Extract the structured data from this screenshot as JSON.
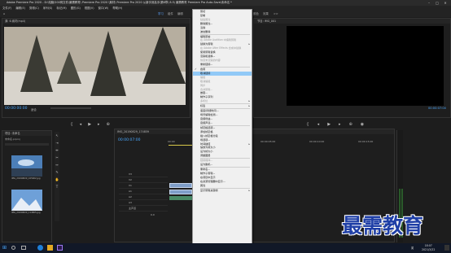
{
  "window": {
    "title": "Adobe Premiere Pro 2020 - D:\\电脑\\500例文件\\最需教育\\ Premiere Pro 2020 \\素材\\ Premiere Pro 2020 从新手到高手\\第8章\\ 8.5\\ 最需教育 Premiere Pro Auto-Save\\未命名 *"
  },
  "menu": [
    "文件(F)",
    "编辑(E)",
    "剪辑(C)",
    "序列(S)",
    "标记(M)",
    "图形(G)",
    "视图(V)",
    "窗口(W)",
    "帮助(H)"
  ],
  "workspace": {
    "home_label": "主页",
    "tabs": [
      "学习",
      "组件",
      "编辑",
      "颜色",
      "效果"
    ],
    "active_index": 0,
    "accent": "#5ca3ff",
    "more_label": ">>"
  },
  "source_monitor": {
    "tab": "源: 6.素材(mp4)",
    "timecode": "00:00:00:00",
    "zoom": "适合"
  },
  "program_monitor": {
    "tab": "节目: IMG_001",
    "timecode": "00:00:07:00"
  },
  "project_panel": {
    "tab": "项目: 未命名",
    "file": "未命名.prproj",
    "items": [
      {
        "name": "IMG_20190829_105902.jpg",
        "duration": "5:00"
      },
      {
        "name": "IMG_20190829_114805.jpg",
        "duration": "5:00"
      }
    ]
  },
  "timeline": {
    "tab": "IMG_20190829_174859",
    "timecode": "00:00:07:00",
    "ruler": [
      "00:00",
      "00:00:05:00",
      "00:00:10:00",
      "00:00:15:00"
    ],
    "tracks": [
      "V3",
      "V2",
      "V1",
      "A1",
      "A2",
      "A3",
      "主声道"
    ],
    "master_value": "0.0"
  },
  "context_menu": {
    "items": [
      {
        "label": "剪切",
        "state": "normal"
      },
      {
        "label": "复制",
        "state": "normal"
      },
      {
        "label": "粘贴属性",
        "state": "disabled"
      },
      {
        "label": "删除属性...",
        "state": "normal"
      },
      {
        "label": "清除",
        "state": "normal"
      },
      {
        "label": "波纹删除",
        "state": "normal"
      },
      {
        "sep": true
      },
      {
        "label": "编辑原始",
        "state": "normal"
      },
      {
        "label": "在 Adobe Audition 中编辑剪辑",
        "state": "disabled"
      },
      {
        "label": "替换为剪辑",
        "state": "normal",
        "arrow": true
      },
      {
        "label": "在 Adobe After Effects 合成中替换",
        "state": "disabled"
      },
      {
        "label": "使用剪辑替换",
        "state": "normal"
      },
      {
        "label": "渲染和替换...",
        "state": "normal"
      },
      {
        "label": "恢复未渲染的内容",
        "state": "disabled"
      },
      {
        "label": "重新链接...",
        "state": "normal"
      },
      {
        "sep": true
      },
      {
        "label": "启用",
        "state": "normal",
        "check": true
      },
      {
        "label": "取消链接",
        "state": "highlight"
      },
      {
        "label": "编组",
        "state": "disabled"
      },
      {
        "label": "取消编组",
        "state": "disabled"
      },
      {
        "label": "同步",
        "state": "disabled"
      },
      {
        "label": "合并剪辑...",
        "state": "disabled"
      },
      {
        "label": "嵌套...",
        "state": "normal"
      },
      {
        "label": "制作子序列",
        "state": "normal"
      },
      {
        "label": "多机位",
        "state": "disabled",
        "arrow": true
      },
      {
        "sep": true
      },
      {
        "label": "标签",
        "state": "normal",
        "arrow": true
      },
      {
        "sep": true
      },
      {
        "label": "速度/持续时间...",
        "state": "normal"
      },
      {
        "label": "场景编辑检测...",
        "state": "normal"
      },
      {
        "label": "音频增益...",
        "state": "normal"
      },
      {
        "label": "音频声道...",
        "state": "normal"
      },
      {
        "sep": true
      },
      {
        "label": "帧定格选项...",
        "state": "normal"
      },
      {
        "label": "添加帧定格",
        "state": "normal"
      },
      {
        "label": "插入帧定格分段",
        "state": "normal"
      },
      {
        "label": "场选项...",
        "state": "normal"
      },
      {
        "label": "时间插值",
        "state": "normal",
        "arrow": true
      },
      {
        "label": "缩放为帧大小",
        "state": "normal"
      },
      {
        "label": "设为帧大小",
        "state": "normal"
      },
      {
        "label": "调整图层",
        "state": "normal"
      },
      {
        "sep": true
      },
      {
        "label": "链接媒体...",
        "state": "disabled"
      },
      {
        "label": "设为脱机...",
        "state": "normal"
      },
      {
        "sep": true
      },
      {
        "label": "重命名...",
        "state": "normal"
      },
      {
        "label": "制作子剪辑...",
        "state": "normal"
      },
      {
        "label": "在项目中显示",
        "state": "normal"
      },
      {
        "label": "在资源管理器中显示...",
        "state": "normal"
      },
      {
        "label": "属性",
        "state": "normal"
      },
      {
        "sep": true
      },
      {
        "label": "显示剪辑关键帧",
        "state": "normal",
        "arrow": true
      }
    ]
  },
  "watermark": "最需教育",
  "taskbar": {
    "time": "18:07",
    "date": "2021/3/22",
    "lang": "英"
  }
}
